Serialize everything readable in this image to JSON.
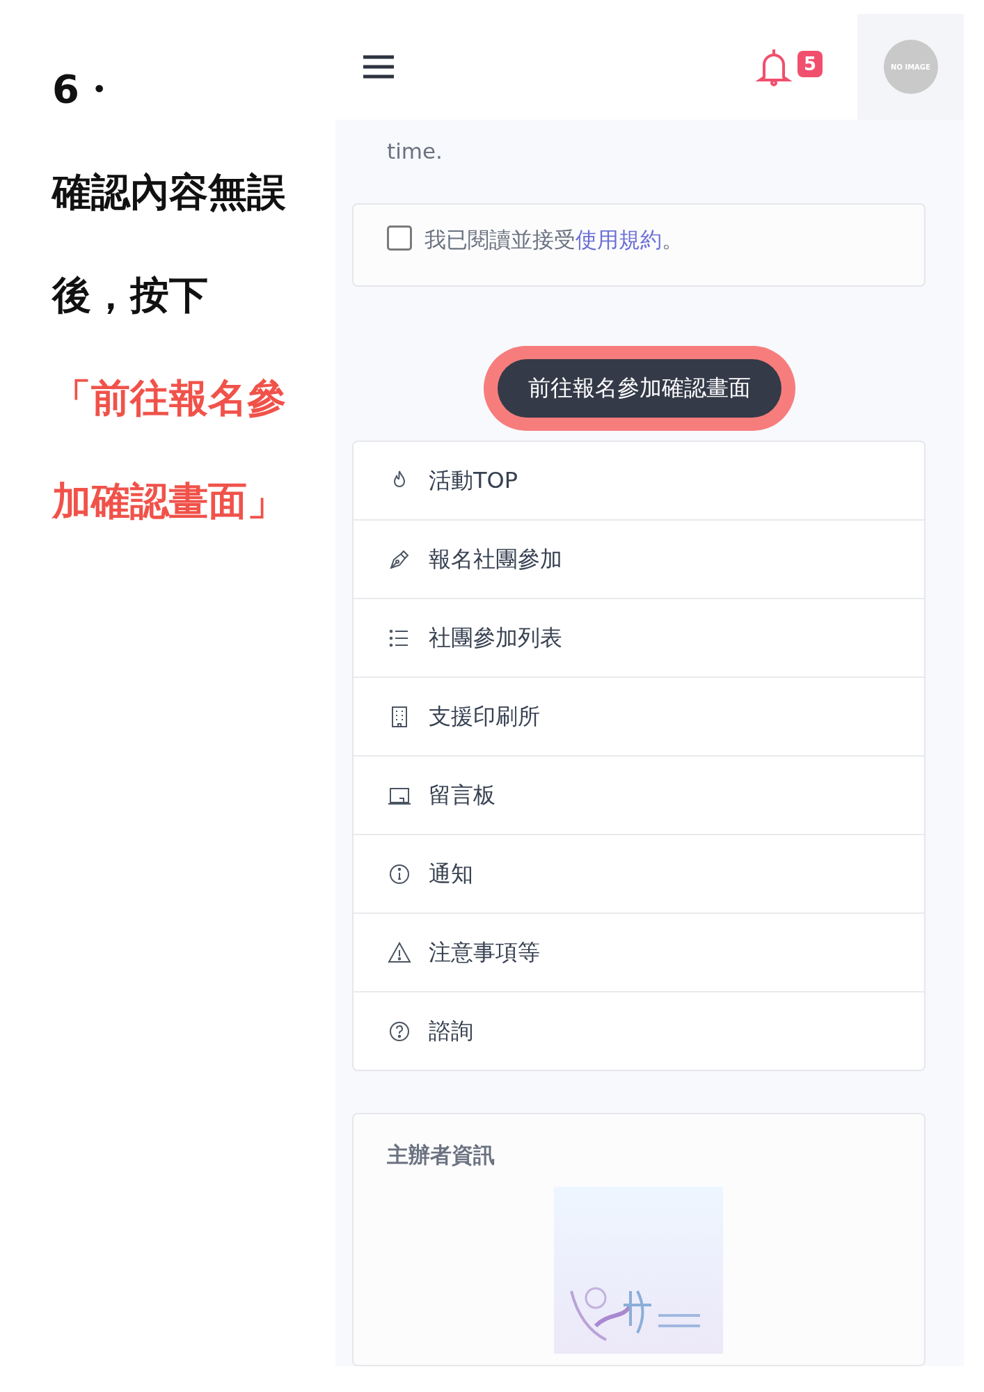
{
  "instruction": {
    "step": "6・",
    "text": "確認內容無誤後，按下",
    "highlight": "「前往報名參加確認畫面」"
  },
  "header": {
    "notification_count": "5",
    "avatar_text": "NO IMAGE"
  },
  "notice_tail": "time.",
  "agreement": {
    "checked": false,
    "text": "我已閱讀並接受",
    "link": "使用規約",
    "end": "。"
  },
  "submit": {
    "label": "前往報名參加確認畫面",
    "highlighted": true
  },
  "menu": [
    {
      "kind": "flame",
      "label": "活動TOP"
    },
    {
      "kind": "pen",
      "label": "報名社團參加"
    },
    {
      "kind": "list",
      "label": "社團參加列表"
    },
    {
      "kind": "building",
      "label": "支援印刷所"
    },
    {
      "kind": "board",
      "label": "留言板"
    },
    {
      "kind": "info",
      "label": "通知"
    },
    {
      "kind": "warning",
      "label": "注意事項等"
    },
    {
      "kind": "question",
      "label": "諮詢"
    }
  ],
  "organizer": {
    "title": "主辦者資訊"
  }
}
